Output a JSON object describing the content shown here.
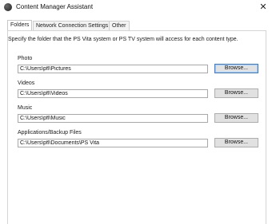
{
  "window": {
    "title": "Content Manager Assistant",
    "close_glyph": "✕"
  },
  "tabs": [
    {
      "label": "Folders",
      "active": true
    },
    {
      "label": "Network Connection Settings",
      "active": false
    },
    {
      "label": "Other",
      "active": false
    }
  ],
  "folders_panel": {
    "description": "Specify the folder that the PS Vita system or PS TV system will access for each content type.",
    "fields": [
      {
        "label": "Photo",
        "value": "C:\\Users\\pfl\\Pictures",
        "button": "Browse..."
      },
      {
        "label": "Videos",
        "value": "C:\\Users\\pfl\\Videos",
        "button": "Browse..."
      },
      {
        "label": "Music",
        "value": "C:\\Users\\pfl\\Music",
        "button": "Browse..."
      },
      {
        "label": "Applications/Backup Files",
        "value": "C:\\Users\\pfl\\Documents\\PS Vita",
        "button": "Browse..."
      }
    ]
  },
  "icons": {
    "app": "ps-logo-icon",
    "close": "close-icon"
  }
}
